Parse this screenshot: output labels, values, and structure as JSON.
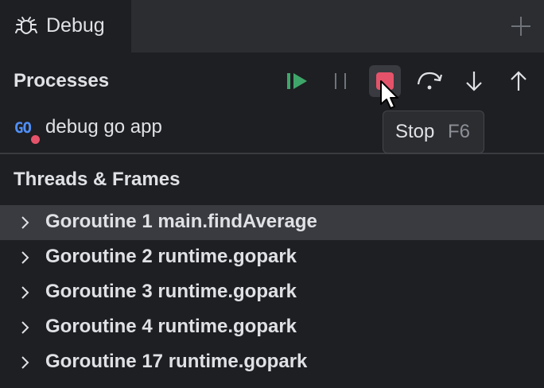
{
  "tab": {
    "label": "Debug",
    "icon": "bug-icon"
  },
  "processes": {
    "title": "Processes",
    "toolbar": [
      {
        "name": "resume-icon",
        "tooltip": ""
      },
      {
        "name": "pause-icon",
        "tooltip": ""
      },
      {
        "name": "stop-icon",
        "tooltip": "Stop"
      },
      {
        "name": "step-over-icon",
        "tooltip": ""
      },
      {
        "name": "step-into-icon",
        "tooltip": ""
      },
      {
        "name": "step-out-icon",
        "tooltip": ""
      }
    ],
    "items": [
      {
        "label": "debug go app",
        "icon": "go-icon",
        "status": "running"
      }
    ]
  },
  "tooltip": {
    "label": "Stop",
    "shortcut": "F6"
  },
  "threads": {
    "title": "Threads & Frames",
    "items": [
      {
        "label": "Goroutine 1 main.findAverage",
        "selected": true
      },
      {
        "label": "Goroutine 2 runtime.gopark",
        "selected": false
      },
      {
        "label": "Goroutine 3 runtime.gopark",
        "selected": false
      },
      {
        "label": "Goroutine 4 runtime.gopark",
        "selected": false
      },
      {
        "label": "Goroutine 17 runtime.gopark",
        "selected": false
      }
    ]
  },
  "colors": {
    "accent_green": "#3fa66a",
    "stop_red": "#e5536a",
    "go_blue": "#4f8ff7"
  }
}
